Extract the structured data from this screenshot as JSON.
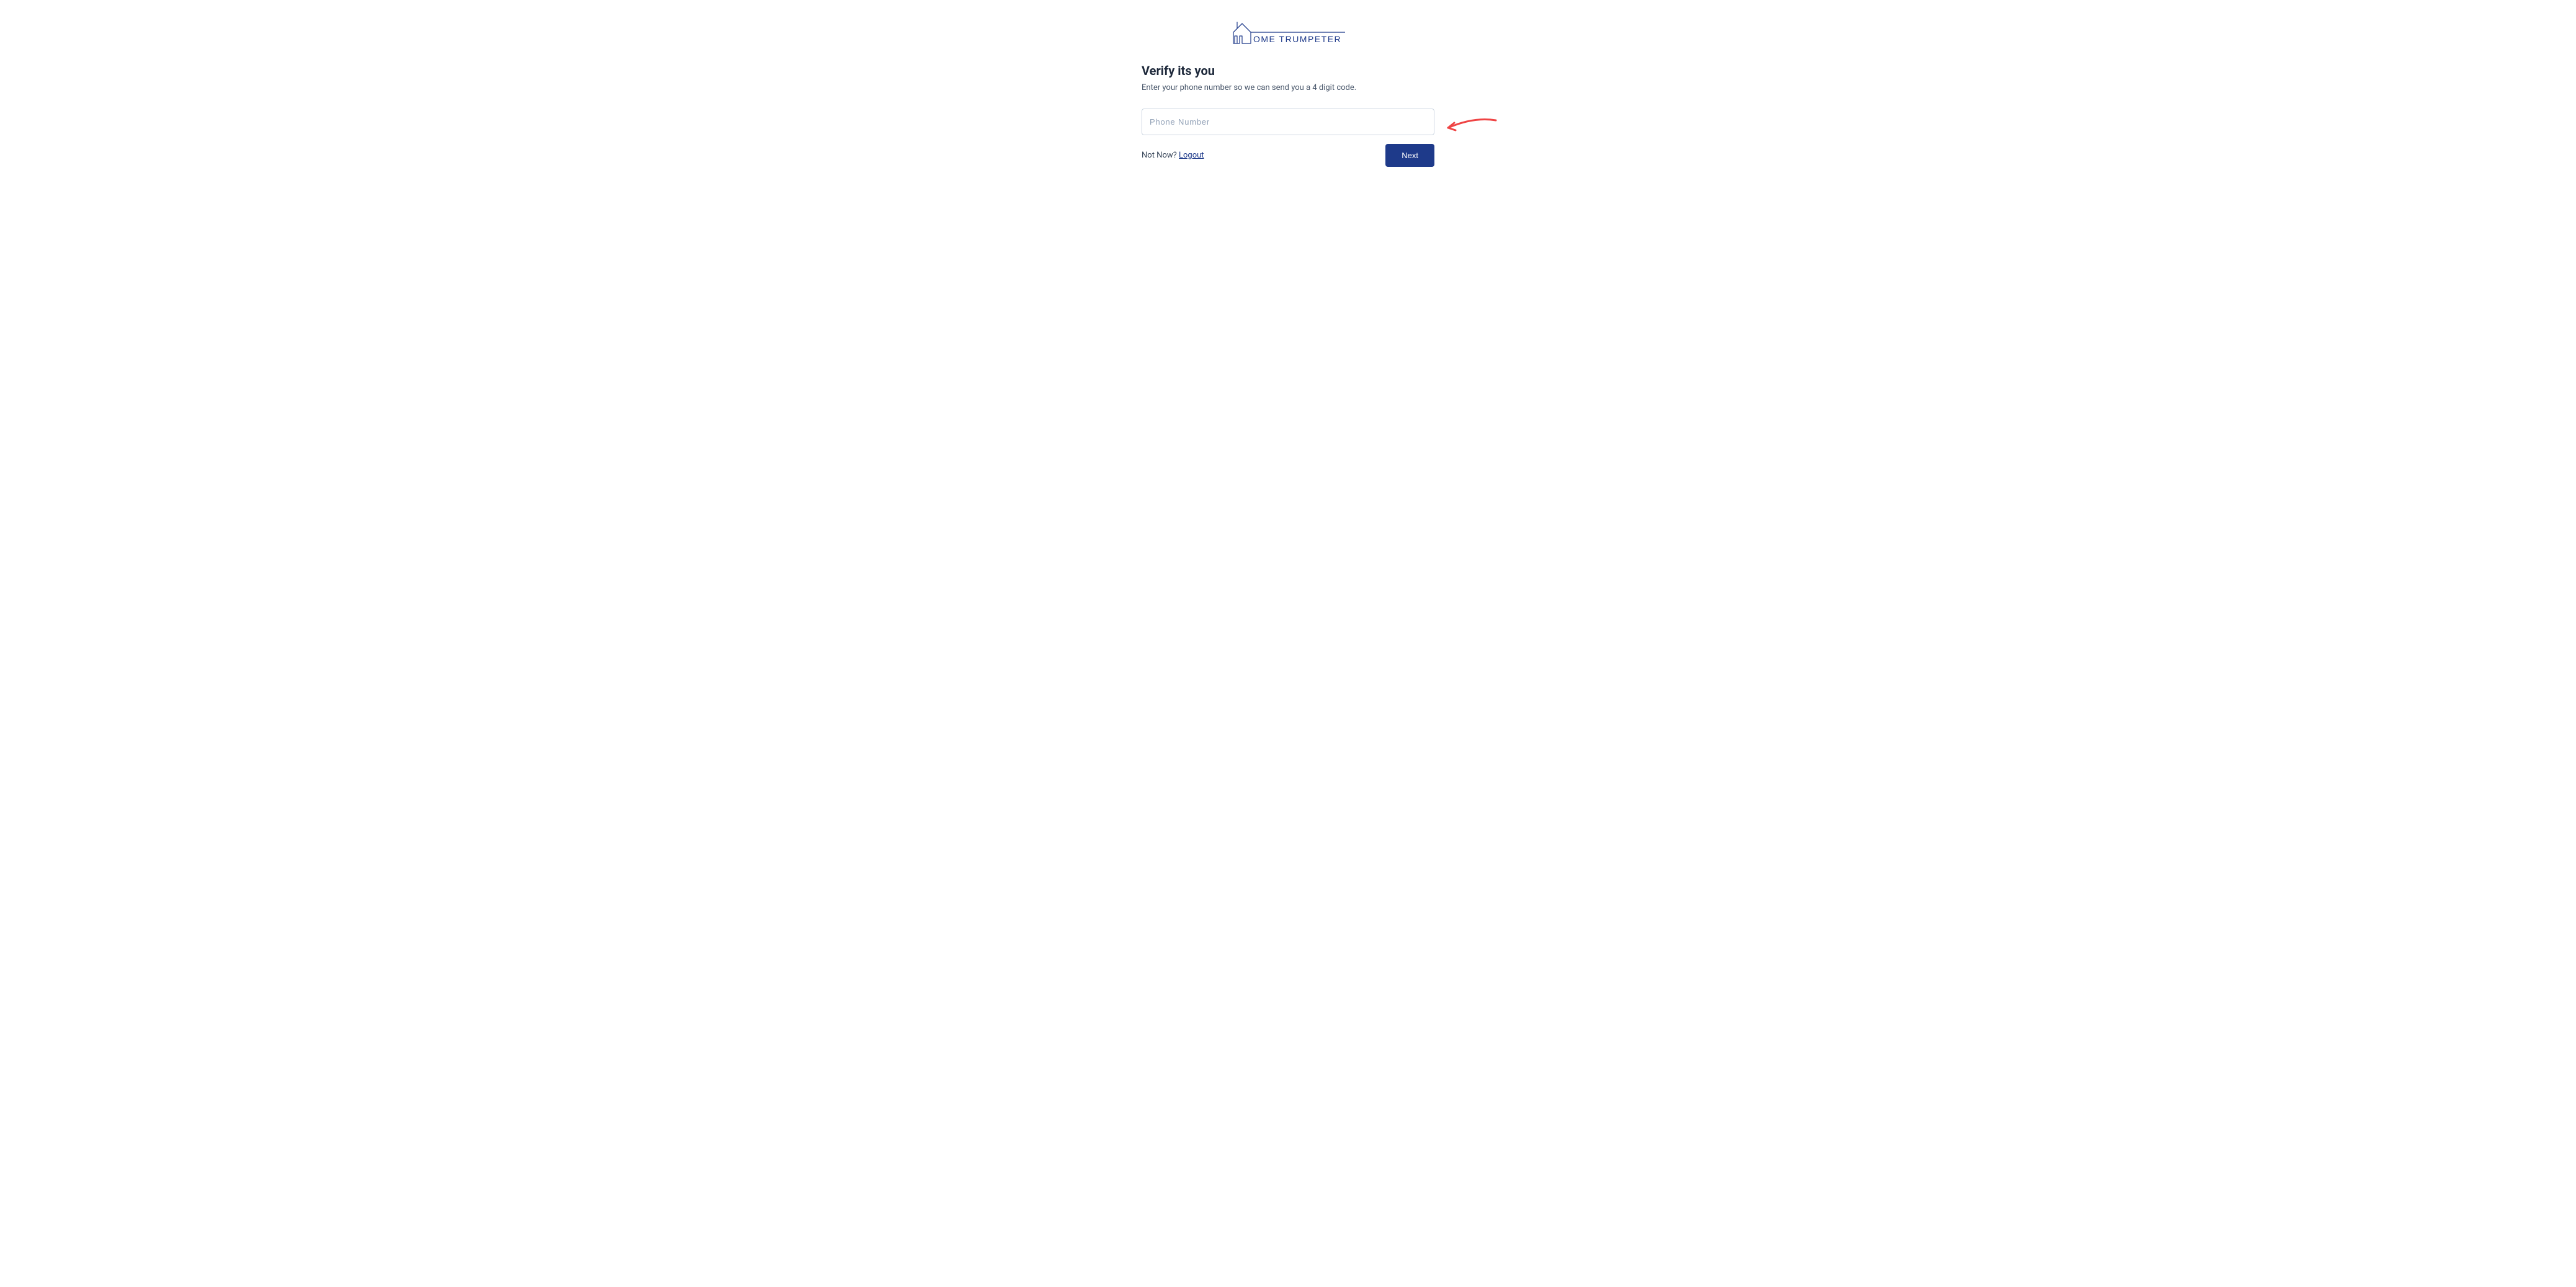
{
  "logo": {
    "brand_text": "OME TRUMPETER",
    "color": "#1e3a8a"
  },
  "form": {
    "heading": "Verify its you",
    "subtext": "Enter your phone number so we can send you a 4 digit code.",
    "phone_placeholder": "Phone Number",
    "phone_value": ""
  },
  "actions": {
    "not_now_text": "Not Now? ",
    "logout_label": "Logout",
    "next_label": "Next"
  },
  "annotation": {
    "arrow_color": "#ef4444"
  }
}
